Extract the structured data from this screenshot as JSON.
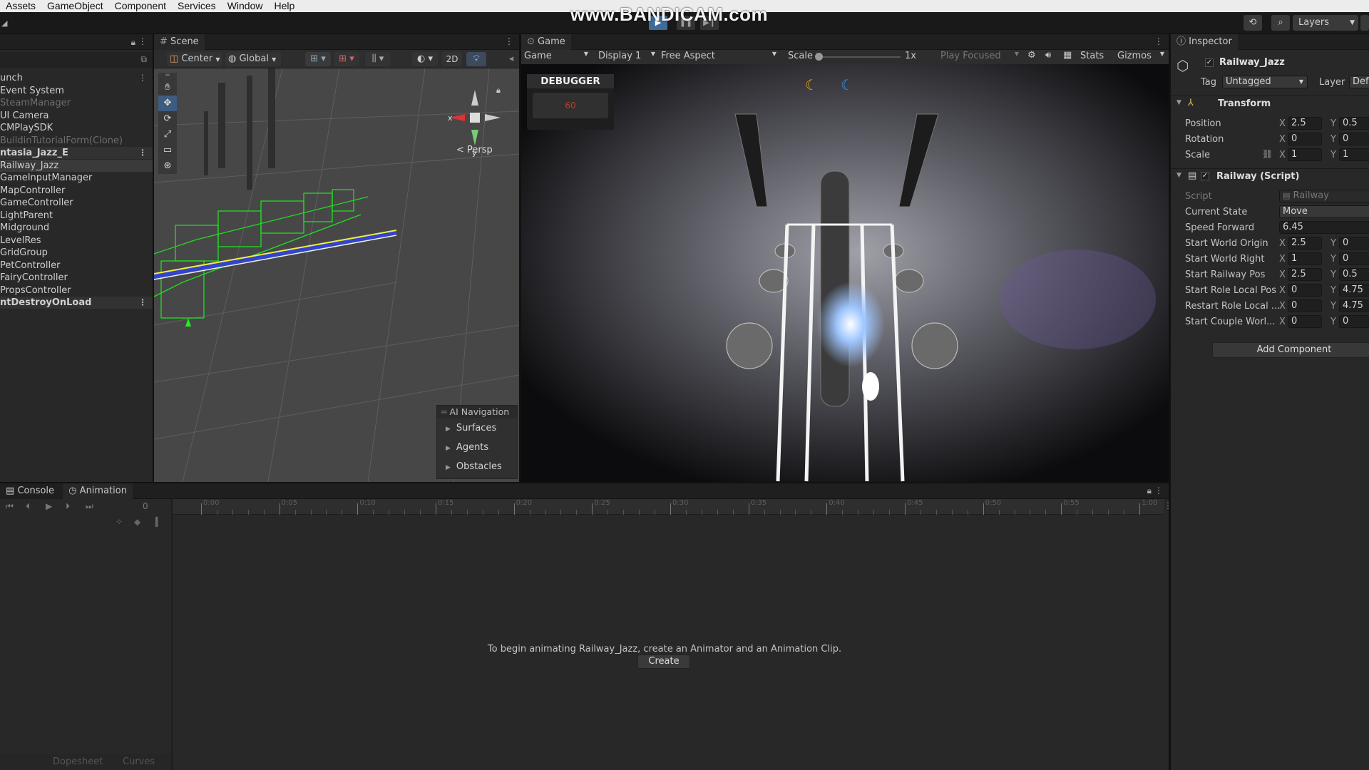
{
  "menubar": [
    "Assets",
    "GameObject",
    "Component",
    "Services",
    "Window",
    "Help"
  ],
  "watermark": "www.BANDICAM.com",
  "toolbar": {
    "layers_label": "Layers"
  },
  "hierarchy": {
    "rows": [
      {
        "label": "unch",
        "style": "normal"
      },
      {
        "label": "Event System",
        "style": "normal"
      },
      {
        "label": "SteamManager",
        "style": "dim"
      },
      {
        "label": "UI Camera",
        "style": "normal"
      },
      {
        "label": "CMPlaySDK",
        "style": "normal"
      },
      {
        "label": "BuildinTutorialForm(Clone)",
        "style": "dim"
      },
      {
        "label": "ntasia_Jazz_E",
        "style": "scene"
      },
      {
        "label": "Railway_Jazz",
        "style": "sel"
      },
      {
        "label": "GameInputManager",
        "style": "normal"
      },
      {
        "label": "MapController",
        "style": "normal"
      },
      {
        "label": "GameController",
        "style": "normal"
      },
      {
        "label": "LightParent",
        "style": "normal"
      },
      {
        "label": "Midground",
        "style": "normal"
      },
      {
        "label": "LevelRes",
        "style": "normal"
      },
      {
        "label": "GridGroup",
        "style": "normal"
      },
      {
        "label": "PetController",
        "style": "normal"
      },
      {
        "label": "FairyController",
        "style": "normal"
      },
      {
        "label": "PropsController",
        "style": "normal"
      },
      {
        "label": "ntDestroyOnLoad",
        "style": "scene"
      }
    ]
  },
  "scene": {
    "tab": "Scene",
    "pivot": "Center",
    "space": "Global",
    "mode_2d": "2D",
    "persp": "< Persp",
    "ai_nav": {
      "title": "AI Navigation",
      "items": [
        "Surfaces",
        "Agents",
        "Obstacles"
      ]
    }
  },
  "game": {
    "tab": "Game",
    "mode": "Game",
    "display": "Display 1",
    "aspect": "Free Aspect",
    "scale_label": "Scale",
    "scale_value": "1x",
    "play_focused": "Play Focused",
    "stats": "Stats",
    "gizmos": "Gizmos",
    "debugger": {
      "title": "DEBUGGER",
      "value": "60"
    }
  },
  "inspector": {
    "tab": "Inspector",
    "object_name": "Railway_Jazz",
    "tag_label": "Tag",
    "tag_value": "Untagged",
    "layer_label": "Layer",
    "layer_value": "Defa",
    "transform": {
      "title": "Transform",
      "rows": [
        {
          "label": "Position",
          "x": "2.5",
          "y": "0.5"
        },
        {
          "label": "Rotation",
          "x": "0",
          "y": "0"
        },
        {
          "label": "Scale",
          "x": "1",
          "y": "1"
        }
      ]
    },
    "script": {
      "title": "Railway (Script)",
      "script_label": "Script",
      "script_value": "Railway",
      "current_state_label": "Current State",
      "current_state_value": "Move",
      "speed_label": "Speed Forward",
      "speed_value": "6.45",
      "vec_rows": [
        {
          "label": "Start World Origin",
          "x": "2.5",
          "y": "0"
        },
        {
          "label": "Start World Right",
          "x": "1",
          "y": "0"
        },
        {
          "label": "Start Railway Pos",
          "x": "2.5",
          "y": "0.5"
        },
        {
          "label": "Start Role Local Pos",
          "x": "0",
          "y": "4.75"
        },
        {
          "label": "Restart Role Local ...",
          "x": "0",
          "y": "4.75"
        },
        {
          "label": "Start Couple Worl...",
          "x": "0",
          "y": "0"
        }
      ]
    },
    "add_component": "Add Component"
  },
  "bottom": {
    "tabs": [
      "Console",
      "Animation"
    ],
    "frame": "0",
    "ticks": [
      "0:00",
      "0:05",
      "0:10",
      "0:15",
      "0:20",
      "0:25",
      "0:30",
      "0:35",
      "0:40",
      "0:45",
      "0:50",
      "0:55",
      "1:00"
    ],
    "message": "To begin animating Railway_Jazz, create an Animator and an Animation Clip.",
    "create": "Create",
    "dopesheet": "Dopesheet",
    "curves": "Curves"
  },
  "colors": {
    "accent": "#3f6b99",
    "selection": "#3a3a3a",
    "debug_red": "#c0392b"
  }
}
